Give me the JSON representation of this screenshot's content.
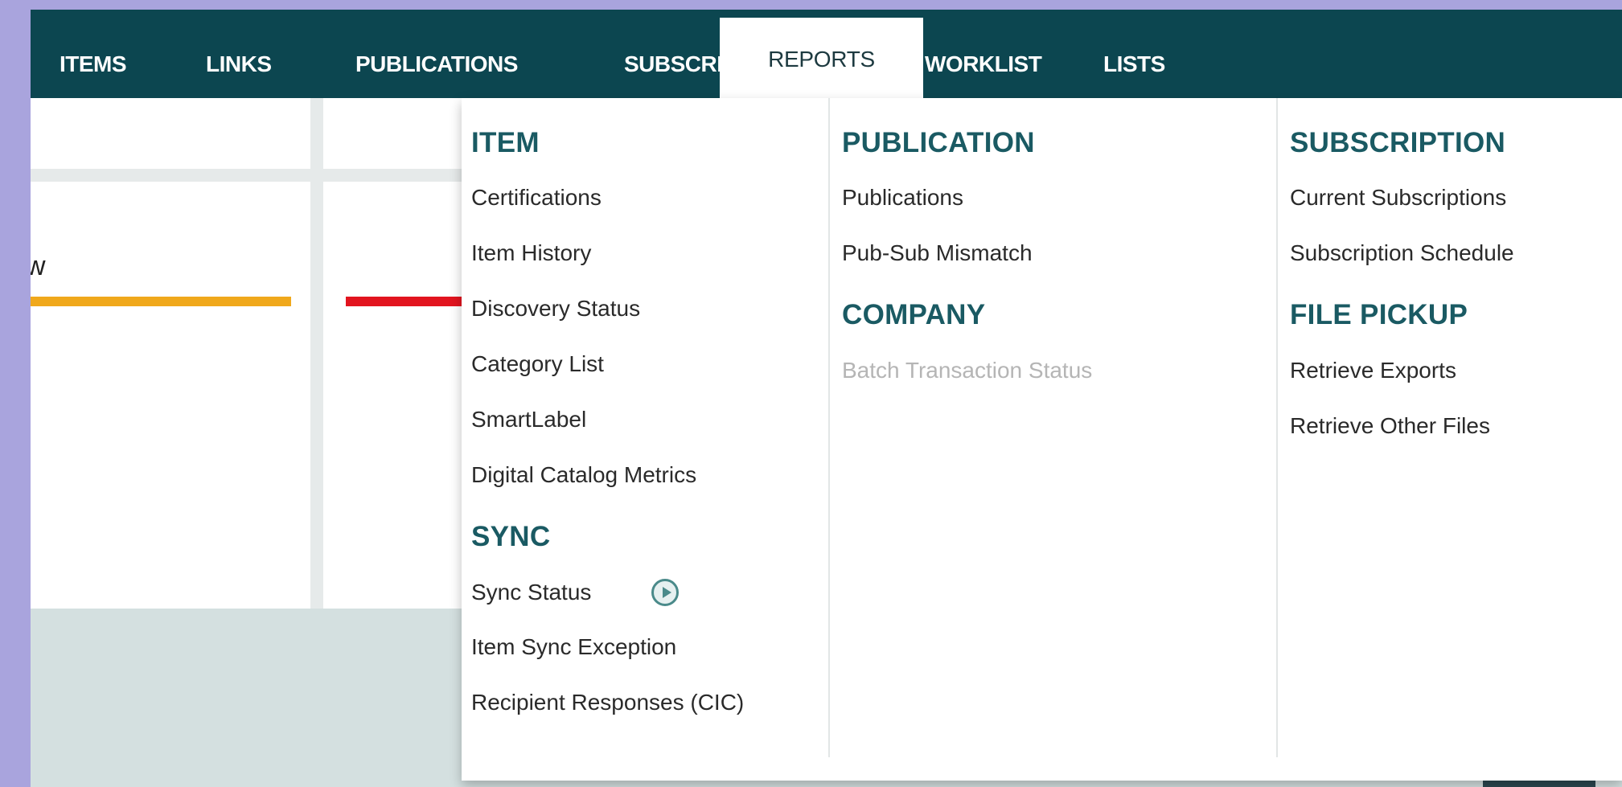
{
  "nav": {
    "items": [
      {
        "label": "ITEMS"
      },
      {
        "label": "LINKS"
      },
      {
        "label": "PUBLICATIONS"
      },
      {
        "label": "SUBSCRIPTIONS"
      },
      {
        "label": "REPORTS",
        "active": true
      },
      {
        "label": "WORKLIST"
      },
      {
        "label": "LISTS"
      }
    ]
  },
  "background": {
    "partial_text": "w",
    "accent_colors": [
      "#f0a81c",
      "#e2141f"
    ]
  },
  "dropdown": {
    "columns": [
      {
        "sections": [
          {
            "heading": "ITEM",
            "links": [
              "Certifications",
              "Item History",
              "Discovery Status",
              "Category List",
              "SmartLabel",
              "Digital Catalog Metrics"
            ]
          },
          {
            "heading": "SYNC",
            "links": [
              "Sync Status",
              "Item Sync Exception",
              "Recipient Responses (CIC)"
            ]
          }
        ]
      },
      {
        "sections": [
          {
            "heading": "PUBLICATION",
            "links": [
              "Publications",
              "Pub-Sub Mismatch"
            ]
          },
          {
            "heading": "COMPANY",
            "links": [
              "Batch Transaction Status"
            ],
            "disabled": [
              "Batch Transaction Status"
            ]
          }
        ]
      },
      {
        "sections": [
          {
            "heading": "SUBSCRIPTION",
            "links": [
              "Current Subscriptions",
              "Subscription Schedule"
            ]
          },
          {
            "heading": "FILE PICKUP",
            "links": [
              "Retrieve Exports",
              "Retrieve Other Files"
            ]
          }
        ]
      }
    ],
    "sync_status_icon": "play-circle-icon"
  },
  "colors": {
    "nav_bg": "#0c4650",
    "heading": "#1a5a63",
    "page_bg": "#a9a4dd"
  }
}
